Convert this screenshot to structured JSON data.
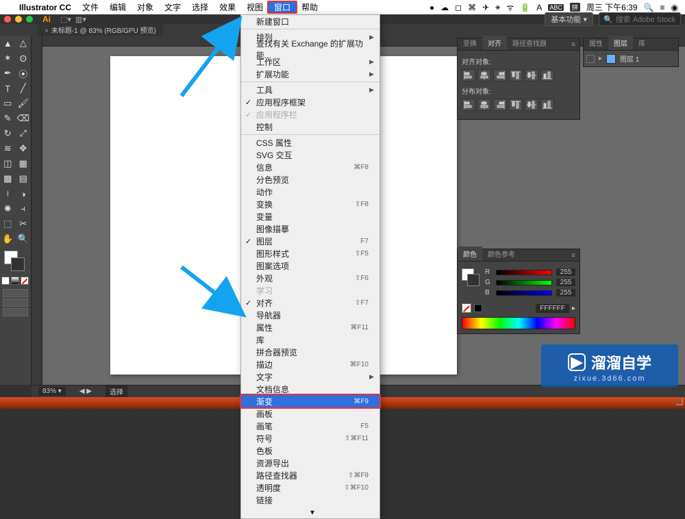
{
  "menubar": {
    "apple": "",
    "app": "Illustrator CC",
    "items": [
      "文件",
      "编辑",
      "对象",
      "文字",
      "选择",
      "效果",
      "视图",
      "窗口",
      "帮助"
    ],
    "highlighted_index": 7,
    "right": {
      "icons": [
        "👤",
        "☁",
        "⌘",
        "✎",
        "✈",
        "*",
        "ᯤ",
        "🔋",
        "A",
        "ABC",
        "拼"
      ],
      "datetime": "周三 下午6:39",
      "extra": [
        "🔍",
        "≡",
        "◉"
      ]
    }
  },
  "app_top": {
    "logo": "Ai",
    "caps": [
      "⬚",
      "▼"
    ],
    "right": {
      "essentials": "基本功能",
      "search_placeholder": "搜索 Adobe Stock"
    }
  },
  "document": {
    "tab": "未标题-1 @ 83% (RGB/GPU 预览)"
  },
  "toolbar": {
    "tools": [
      [
        "selection",
        "direct-selection"
      ],
      [
        "magic-wand",
        "lasso"
      ],
      [
        "pen",
        "curvature"
      ],
      [
        "type",
        "line"
      ],
      [
        "rectangle",
        "paintbrush"
      ],
      [
        "pencil",
        "eraser"
      ],
      [
        "rotate",
        "scale"
      ],
      [
        "width",
        "free-transform"
      ],
      [
        "shape-builder",
        "perspective"
      ],
      [
        "mesh",
        "gradient"
      ],
      [
        "eyedropper",
        "blend"
      ],
      [
        "symbol-sprayer",
        "graph"
      ],
      [
        "artboard",
        "slice"
      ],
      [
        "hand",
        "zoom"
      ]
    ]
  },
  "status": {
    "zoom": "83%",
    "sel": "选择"
  },
  "dropdown": {
    "groups": [
      [
        {
          "label": "新建窗口"
        }
      ],
      [
        {
          "label": "排列",
          "sub": true
        },
        {
          "label": "查找有关 Exchange 的扩展功能..."
        },
        {
          "label": "工作区",
          "sub": true
        },
        {
          "label": "扩展功能",
          "sub": true
        }
      ],
      [
        {
          "label": "工具",
          "sub": true
        },
        {
          "label": "应用程序框架",
          "check": true
        },
        {
          "label": "应用程序栏",
          "check": true,
          "disabled": true
        },
        {
          "label": "控制"
        }
      ],
      [
        {
          "label": "CSS 属性"
        },
        {
          "label": "SVG 交互"
        },
        {
          "label": "信息",
          "shortcut": "⌘F8"
        },
        {
          "label": "分色预览"
        },
        {
          "label": "动作"
        },
        {
          "label": "变换",
          "shortcut": "⇧F8"
        },
        {
          "label": "变量"
        },
        {
          "label": "图像描摹"
        },
        {
          "label": "图层",
          "check": true,
          "shortcut": "F7"
        },
        {
          "label": "图形样式",
          "shortcut": "⇧F5"
        },
        {
          "label": "图案选项"
        },
        {
          "label": "外观",
          "shortcut": "⇧F6"
        },
        {
          "label": "学习",
          "disabled": true
        },
        {
          "label": "对齐",
          "check": true,
          "shortcut": "⇧F7"
        },
        {
          "label": "导航器"
        },
        {
          "label": "属性",
          "shortcut": "⌘F11"
        },
        {
          "label": "库"
        },
        {
          "label": "拼合器预览"
        },
        {
          "label": "描边",
          "shortcut": "⌘F10"
        },
        {
          "label": "文字",
          "sub": true
        },
        {
          "label": "文档信息"
        },
        {
          "label": "渐变",
          "shortcut": "⌘F9",
          "selected": true,
          "redbox": true
        },
        {
          "label": "画板"
        },
        {
          "label": "画笔",
          "shortcut": "F5"
        },
        {
          "label": "符号",
          "shortcut": "⇧⌘F11"
        },
        {
          "label": "色板"
        },
        {
          "label": "资源导出"
        },
        {
          "label": "路径查找器",
          "shortcut": "⇧⌘F9"
        },
        {
          "label": "透明度",
          "shortcut": "⇧⌘F10"
        },
        {
          "label": "链接"
        }
      ]
    ]
  },
  "panels": {
    "align": {
      "tabs": [
        "变换",
        "对齐",
        "路径查找器"
      ],
      "active_tab": 1,
      "section1": "对齐对象:",
      "section2": "分布对象:"
    },
    "props": {
      "tabs": [
        "属性",
        "图层",
        "库"
      ],
      "active_tab": 1,
      "layer_name": "图层 1"
    },
    "color": {
      "tabs": [
        "颜色",
        "颜色参考"
      ],
      "active_tab": 0,
      "r": "255",
      "g": "255",
      "b": "255",
      "hex": "FFFFFF"
    }
  },
  "watermark": {
    "title": "溜溜自学",
    "sub": "zixue.3d66.com"
  }
}
